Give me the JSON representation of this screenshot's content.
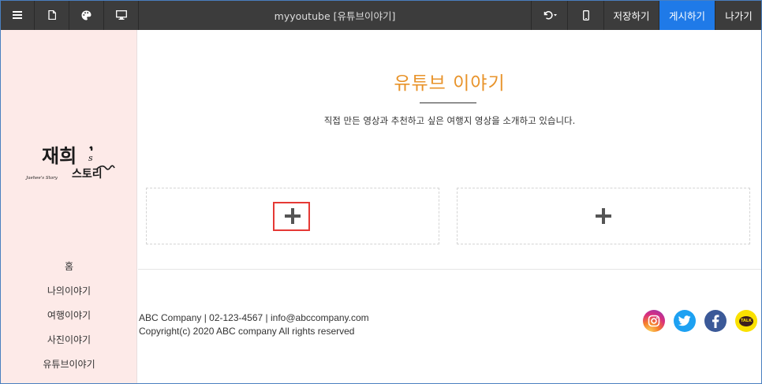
{
  "toolbar": {
    "title": "myyoutube [유튜브이야기]",
    "save_label": "저장하기",
    "publish_label": "게시하기",
    "exit_label": "나가기",
    "icons": [
      "menu-icon",
      "page-icon",
      "palette-icon",
      "desktop-icon",
      "undo-icon",
      "mobile-icon"
    ],
    "publish_color": "#1f7ae8"
  },
  "sidebar": {
    "background": "#fdeae8",
    "logo": {
      "main": "재희",
      "sub": "스토리",
      "suffix": "s",
      "script": "Jaehee's Story"
    },
    "nav": [
      {
        "label": "홈"
      },
      {
        "label": "나의이야기"
      },
      {
        "label": "여행이야기"
      },
      {
        "label": "사진이야기"
      },
      {
        "label": "유튜브이야기"
      }
    ]
  },
  "main": {
    "title": "유튜브 이야기",
    "title_color": "#e8932a",
    "subtitle": "직접 만든 영상과 추천하고 싶은 여행지 영상을 소개하고 있습니다.",
    "slots": [
      {
        "icon": "plus-icon",
        "highlighted": true
      },
      {
        "icon": "plus-icon",
        "highlighted": false
      }
    ],
    "highlight_color": "#e53935"
  },
  "footer": {
    "line1": "ABC Company | 02-123-4567 | info@abccompany.com",
    "line2": "Copyright(c) 2020 ABC company All rights reserved",
    "social": [
      {
        "icon": "instagram-icon"
      },
      {
        "icon": "twitter-icon"
      },
      {
        "icon": "facebook-icon"
      },
      {
        "icon": "kakaotalk-icon",
        "label": "TALK"
      }
    ]
  }
}
